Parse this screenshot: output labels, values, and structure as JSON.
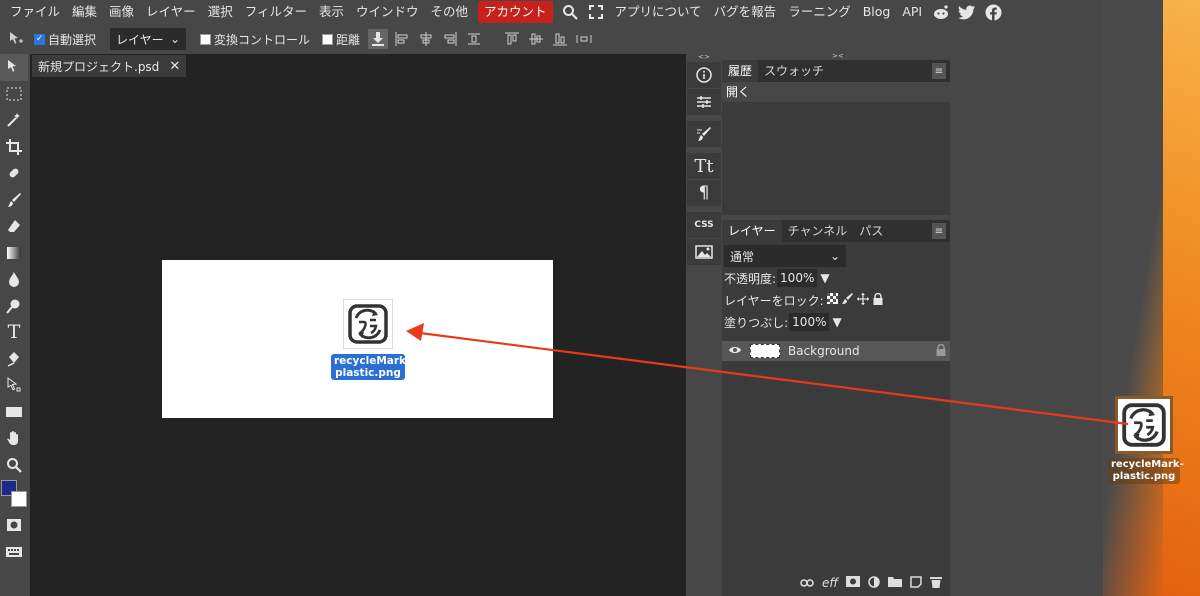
{
  "menubar": {
    "items": [
      "ファイル",
      "編集",
      "画像",
      "レイヤー",
      "選択",
      "フィルター",
      "表示",
      "ウインドウ",
      "その他"
    ],
    "account": "アカウント",
    "extra": [
      "アプリについて",
      "バグを報告",
      "ラーニング",
      "Blog",
      "API"
    ],
    "icons": [
      "search-icon",
      "fullscreen-icon",
      "reddit-icon",
      "twitter-icon",
      "facebook-icon"
    ]
  },
  "options": {
    "auto_select": "自動選択",
    "target": "レイヤー",
    "transform": "変換コントロール",
    "distance": "距離"
  },
  "document": {
    "tab_name": "新規プロジェクト.psd",
    "dropped_file": "recycleMark-plastic.png"
  },
  "history": {
    "tabs": [
      "履歴",
      "スウォッチ"
    ],
    "rows": [
      "開く"
    ]
  },
  "layers": {
    "tabs": [
      "レイヤー",
      "チャンネル",
      "パス"
    ],
    "blend_mode": "通常",
    "opacity_label": "不透明度:",
    "opacity_value": "100%",
    "lock_label": "レイヤーをロック:",
    "fill_label": "塗りつぶし:",
    "fill_value": "100%",
    "layer_name": "Background",
    "footer_icons": [
      "link-icon",
      "effects-icon",
      "mask-icon",
      "adjustment-icon",
      "folder-icon",
      "new-layer-icon",
      "trash-icon"
    ]
  },
  "desktop": {
    "file_label": "recycleMark-plastic.png"
  },
  "colors": {
    "accent": "#c8201a",
    "selection": "#2b6fd6",
    "arrow": "#e8391c",
    "foreground": "#1b2a8c"
  }
}
